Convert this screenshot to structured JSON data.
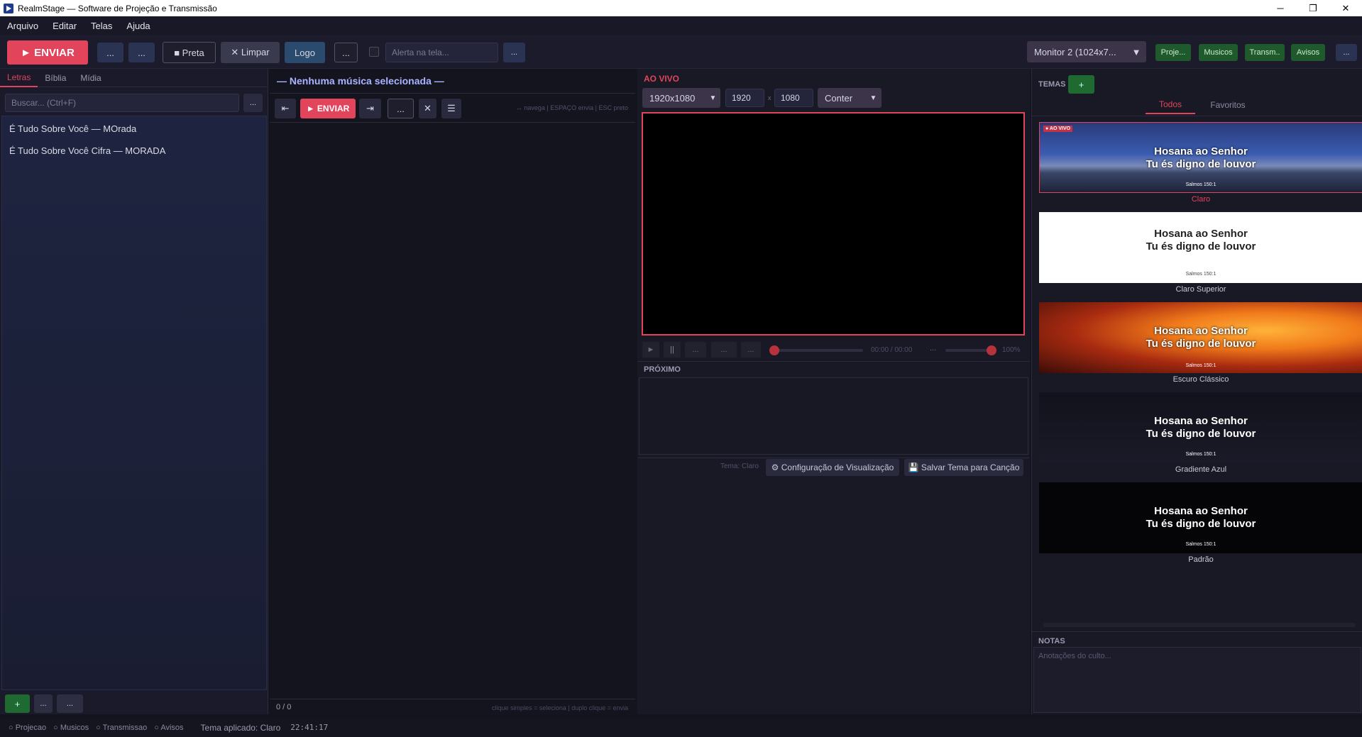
{
  "window": {
    "title": "RealmStage — Software de Projeção e Transmissão"
  },
  "menu": [
    "Arquivo",
    "Editar",
    "Telas",
    "Ajuda"
  ],
  "toolbar": {
    "send": "► ENVIAR",
    "more1": "...",
    "more2": "...",
    "black": "■ Preta",
    "clear": "✕ Limpar",
    "logo": "Logo",
    "more3": "...",
    "alert_placeholder": "Alerta na tela...",
    "more4": "...",
    "monitor": "Monitor 2 (1024x7...",
    "chips": [
      "Proje...",
      "Musicos",
      "Transm..",
      "Avisos"
    ],
    "more5": "..."
  },
  "left": {
    "tabs": [
      "Letras",
      "Bíblia",
      "Mídia"
    ],
    "search_placeholder": "Buscar... (Ctrl+F)",
    "search_more": "...",
    "items": [
      "É Tudo Sobre Você — MOrada",
      "É Tudo Sobre Você Cifra — MORADA"
    ],
    "add": "+",
    "btn_a": "...",
    "btn_b": "..."
  },
  "middle": {
    "title": "— Nenhuma música selecionada —",
    "send": "► ENVIAR",
    "hint": "↔ navega  |  ESPAÇO envia  |  ESC preto",
    "counter": "0 / 0",
    "footer_hint": "clique simples = seleciona  |  duplo clique = envia",
    "dots": "..."
  },
  "live": {
    "title": "AO VIVO",
    "resolution": "1920x1080",
    "width": "1920",
    "x": "x",
    "height": "1080",
    "fit": "Conter",
    "time": "00:00 / 00:00",
    "volume": "100%",
    "next_label": "PRÓXIMO",
    "theme_label": "Tema: Claro",
    "config": "⚙ Configuração de Visualização",
    "save_theme": "💾 Salvar Tema para Canção",
    "ctrl_more": "..."
  },
  "themes": {
    "header": "TEMAS",
    "add": "+",
    "tabs": [
      "Todos",
      "Favoritos"
    ],
    "live_badge": "● AO VIVO",
    "line1": "Hosana ao Senhor",
    "line2": "Tu és digno de louvor",
    "ref": "Salmos 150:1",
    "names": [
      "Claro",
      "Claro Superior",
      "Escuro Clássico",
      "Gradiente Azul",
      "Padrão"
    ],
    "notes_header": "NOTAS",
    "notes_placeholder": "Anotações do culto..."
  },
  "status": {
    "items": [
      "○ Projecao",
      "○ Musicos",
      "○ Transmissao",
      "○ Avisos"
    ],
    "theme": "Tema aplicado: Claro",
    "clock": "22:41:17"
  },
  "colors": {
    "accent": "#e2445c",
    "panel": "#191926",
    "green": "#1e5a2c"
  }
}
